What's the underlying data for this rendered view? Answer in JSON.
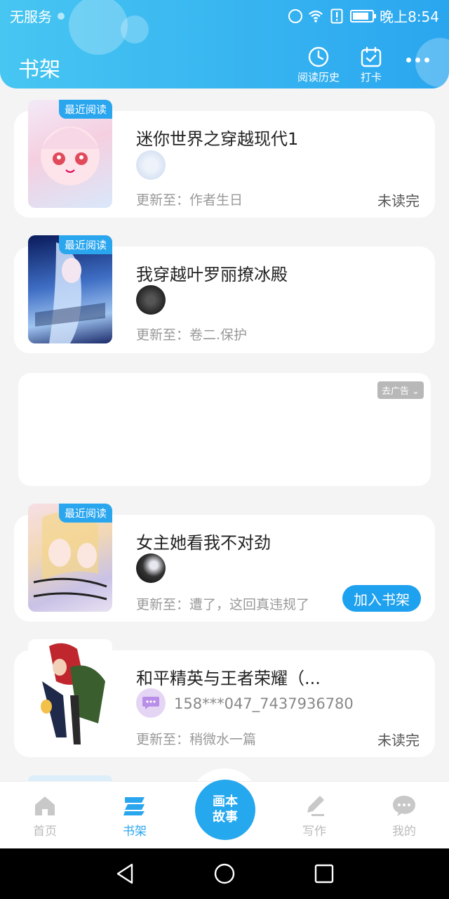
{
  "status_bar": {
    "carrier": "无服务",
    "time": "晚上8:54"
  },
  "header": {
    "title": "书架",
    "history_label": "阅读历史",
    "checkin_label": "打卡",
    "accent": "#2aa6ef"
  },
  "books": [
    {
      "badge": "最近阅读",
      "title": "迷你世界之穿越现代1",
      "author": "",
      "update": "更新至：作者生日",
      "status": "未读完",
      "action": ""
    },
    {
      "badge": "最近阅读",
      "title": "我穿越叶罗丽撩冰殿",
      "author": "",
      "update": "更新至：卷二.保护",
      "status": "",
      "action": ""
    },
    {
      "badge": "最近阅读",
      "title": "女主她看我不对劲",
      "author": "",
      "update": "更新至：遭了，这回真违规了",
      "status": "",
      "action": "加入书架"
    },
    {
      "badge": "",
      "title": "和平精英与王者荣耀（...",
      "author": "158***047_7437936780",
      "update": "更新至：稍微水一篇",
      "status": "未读完",
      "action": ""
    }
  ],
  "ad": {
    "label": "去广告"
  },
  "bottom_nav": {
    "home": "首页",
    "shelf": "书架",
    "center_line1": "画本",
    "center_line2": "故事",
    "write": "写作",
    "mine": "我的"
  }
}
